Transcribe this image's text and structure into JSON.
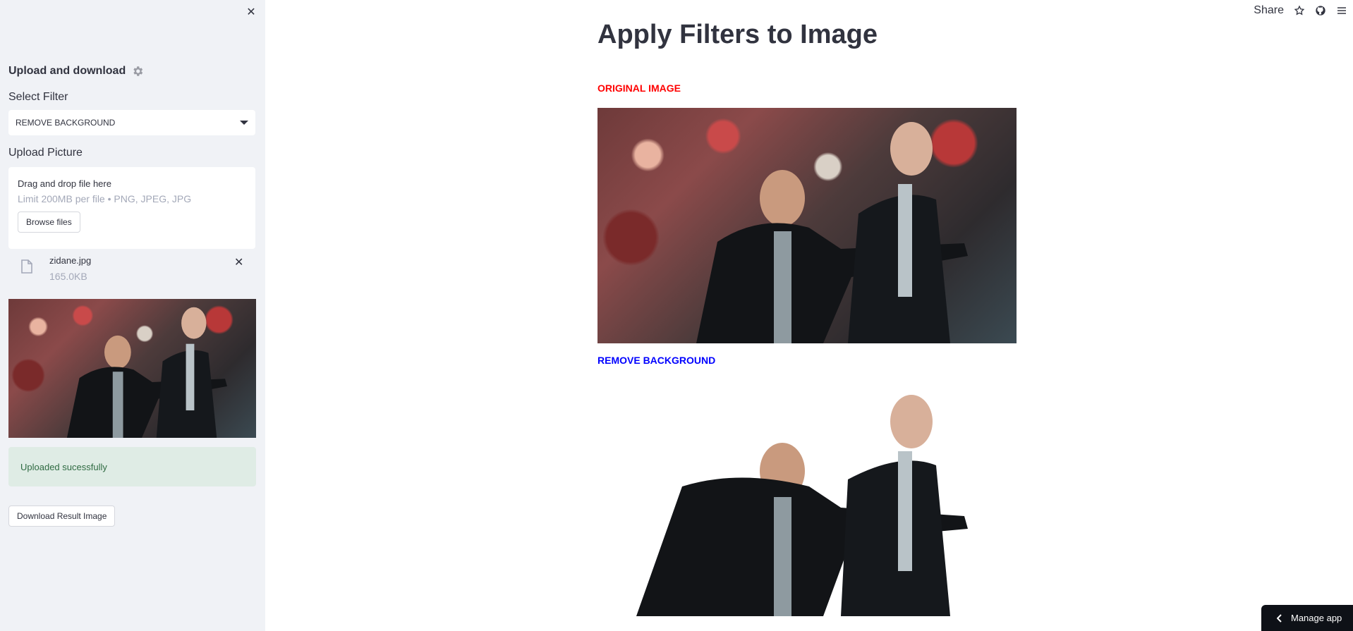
{
  "sidebar": {
    "close_glyph": "✕",
    "title": "Upload and download",
    "filter_label": "Select Filter",
    "filter_value": "REMOVE BACKGROUND",
    "upload_label": "Upload Picture",
    "dropzone_title": "Drag and drop file here",
    "dropzone_limit": "Limit 200MB per file • PNG, JPEG, JPG",
    "browse_label": "Browse files",
    "file_name": "zidane.jpg",
    "file_size": "165.0KB",
    "file_remove_glyph": "✕",
    "success_text": "Uploaded sucessfully",
    "download_label": "Download Result Image"
  },
  "topbar": {
    "share_label": "Share"
  },
  "main": {
    "title": "Apply Filters to Image",
    "original_caption": "ORIGINAL IMAGE",
    "result_caption": "REMOVE BACKGROUND"
  },
  "manage_app": {
    "label": "Manage app"
  },
  "colors": {
    "sidebar_bg": "#f0f2f6",
    "original_caption": "#ff0000",
    "result_caption": "#0000ff",
    "success_bg": "#dfece5",
    "manage_bg": "#0e1117"
  }
}
